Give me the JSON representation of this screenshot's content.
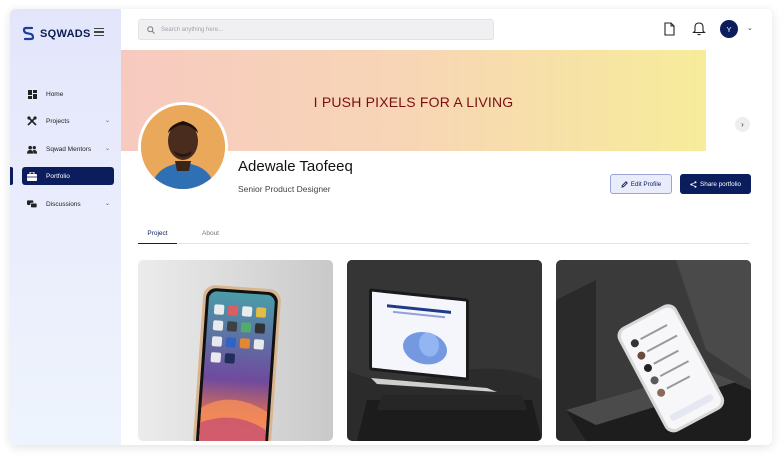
{
  "brand": {
    "name": "SQWADS"
  },
  "sidebar": {
    "items": [
      {
        "label": "Home",
        "icon": "home-icon",
        "has_chevron": false
      },
      {
        "label": "Projects",
        "icon": "tools-icon",
        "has_chevron": true
      },
      {
        "label": "Sqwad Mentors",
        "icon": "people-icon",
        "has_chevron": true
      },
      {
        "label": "Portfolio",
        "icon": "briefcase-icon",
        "has_chevron": false,
        "active": true
      },
      {
        "label": "Discussions",
        "icon": "chat-icon",
        "has_chevron": true
      }
    ],
    "chevron": "⌄"
  },
  "topbar": {
    "search_placeholder": "Search anything here...",
    "avatar_initial": "Y",
    "avatar_chevron": "⌄"
  },
  "banner": {
    "text": "I PUSH PIXELS FOR A LIVING",
    "next": "›"
  },
  "profile": {
    "name": "Adewale Taofeeq",
    "role": "Senior Product Designer"
  },
  "actions": {
    "edit_label": "Edit Profile",
    "share_label": "Share portfolio"
  },
  "tabs": [
    {
      "label": "Project",
      "active": true
    },
    {
      "label": "About",
      "active": false
    }
  ],
  "projects": [
    {
      "image": "iphone-mockup"
    },
    {
      "image": "laptop-mockup"
    },
    {
      "image": "phone-on-pedestal-mockup"
    }
  ],
  "colors": {
    "brand_navy": "#0b1d5c",
    "banner_text": "#7a0f12",
    "banner_start": "#f7cac0",
    "banner_end": "#f7ec9a"
  }
}
